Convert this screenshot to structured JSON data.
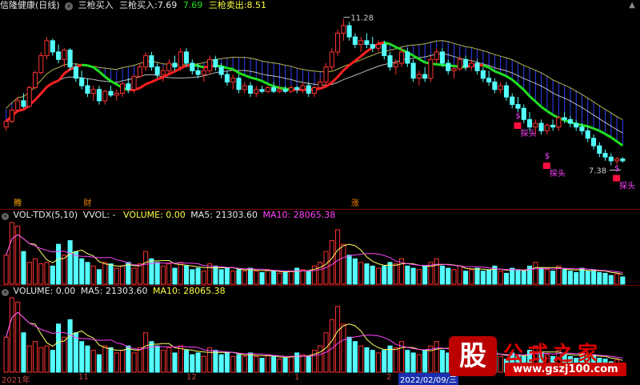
{
  "header": {
    "stock_name": "信隆健康(日线)",
    "ind1_name": "三枪买入",
    "ind2_label": "三枪买入:",
    "ind2_value": "7.69",
    "ind3_value": "7.69",
    "ind4_label": "三枪卖出:",
    "ind4_value": "8.51"
  },
  "panel2": {
    "title": "VOL-TDX(5,10)",
    "vvol": "VVOL: -",
    "volume": "VOLUME: 0.00",
    "ma5": "MA5: 21303.60",
    "ma10": "MA10: 28065.38"
  },
  "panel3": {
    "volume": "VOLUME: 0.00",
    "ma5": "MA5: 21303.60",
    "ma10": "MA10: 28065.38"
  },
  "annotations": {
    "high": "11.28",
    "low": "7.38",
    "signal_label": "探头",
    "dollar": "$",
    "bottom_marks": [
      "腾",
      "财",
      "涨"
    ]
  },
  "xaxis": {
    "labels": [
      "2021年",
      "11",
      "12",
      "1",
      "2",
      "2022/02/09/三"
    ]
  },
  "watermark": {
    "logo": "股",
    "text": "公式之家",
    "url": "www.gszj100.com"
  },
  "colors": {
    "up": "#ff3232",
    "down": "#54ffff",
    "ma_red": "#ff2020",
    "ma_green": "#20e020",
    "line_yellow": "#ffff66",
    "line_white": "#e8e8e8",
    "line_magenta": "#ff44ff",
    "cloud_blue": "#3040ff"
  },
  "chart_data": {
    "type": "candlestick",
    "period": "daily",
    "y_high": 11.28,
    "y_low": 7.38,
    "candles": [
      [
        8.4,
        8.6,
        8.3,
        8.55
      ],
      [
        8.55,
        8.9,
        8.5,
        8.85
      ],
      [
        8.85,
        9.2,
        8.8,
        9.1
      ],
      [
        9.1,
        9.3,
        8.9,
        8.95
      ],
      [
        8.95,
        9.5,
        8.9,
        9.45
      ],
      [
        9.45,
        9.9,
        9.4,
        9.85
      ],
      [
        9.85,
        10.4,
        9.8,
        10.3
      ],
      [
        10.3,
        10.8,
        10.2,
        10.7
      ],
      [
        10.7,
        10.75,
        10.3,
        10.4
      ],
      [
        10.4,
        10.6,
        10.1,
        10.2
      ],
      [
        10.2,
        10.5,
        10.0,
        10.45
      ],
      [
        10.45,
        10.5,
        9.9,
        10.0
      ],
      [
        10.0,
        10.1,
        9.6,
        9.7
      ],
      [
        9.7,
        9.9,
        9.4,
        9.5
      ],
      [
        9.5,
        9.7,
        9.2,
        9.3
      ],
      [
        9.3,
        9.5,
        9.1,
        9.4
      ],
      [
        9.4,
        9.5,
        9.0,
        9.1
      ],
      [
        9.1,
        9.4,
        9.0,
        9.35
      ],
      [
        9.35,
        9.5,
        9.2,
        9.25
      ],
      [
        9.25,
        9.4,
        9.1,
        9.3
      ],
      [
        9.3,
        9.6,
        9.2,
        9.55
      ],
      [
        9.55,
        9.7,
        9.3,
        9.4
      ],
      [
        9.4,
        9.8,
        9.3,
        9.75
      ],
      [
        9.75,
        10.1,
        9.7,
        10.0
      ],
      [
        10.0,
        10.4,
        9.9,
        10.3
      ],
      [
        10.3,
        10.4,
        9.9,
        10.0
      ],
      [
        10.0,
        10.1,
        9.7,
        9.8
      ],
      [
        9.8,
        10.0,
        9.6,
        9.9
      ],
      [
        9.9,
        10.2,
        9.8,
        10.1
      ],
      [
        10.1,
        10.3,
        9.9,
        10.0
      ],
      [
        10.0,
        10.5,
        9.9,
        10.4
      ],
      [
        10.4,
        10.5,
        10.0,
        10.1
      ],
      [
        10.1,
        10.2,
        9.8,
        9.9
      ],
      [
        9.9,
        10.1,
        9.7,
        9.8
      ],
      [
        9.8,
        10.0,
        9.6,
        9.9
      ],
      [
        9.9,
        10.3,
        9.8,
        10.2
      ],
      [
        10.2,
        10.3,
        9.9,
        10.0
      ],
      [
        10.0,
        10.1,
        9.7,
        9.8
      ],
      [
        9.8,
        9.9,
        9.5,
        9.6
      ],
      [
        9.6,
        9.8,
        9.4,
        9.7
      ],
      [
        9.7,
        9.8,
        9.3,
        9.4
      ],
      [
        9.4,
        9.6,
        9.3,
        9.5
      ],
      [
        9.5,
        9.6,
        9.2,
        9.3
      ],
      [
        9.3,
        9.5,
        9.2,
        9.4
      ],
      [
        9.4,
        9.5,
        9.3,
        9.35
      ],
      [
        9.35,
        9.5,
        9.3,
        9.45
      ],
      [
        9.45,
        9.6,
        9.3,
        9.35
      ],
      [
        9.35,
        9.5,
        9.3,
        9.4
      ],
      [
        9.4,
        9.5,
        9.3,
        9.35
      ],
      [
        9.35,
        9.5,
        9.3,
        9.45
      ],
      [
        9.45,
        9.5,
        9.3,
        9.4
      ],
      [
        9.4,
        9.6,
        9.3,
        9.5
      ],
      [
        9.5,
        9.6,
        9.2,
        9.3
      ],
      [
        9.3,
        9.5,
        9.2,
        9.45
      ],
      [
        9.45,
        9.7,
        9.4,
        9.6
      ],
      [
        9.6,
        10.1,
        9.5,
        10.0
      ],
      [
        10.0,
        10.5,
        9.9,
        10.4
      ],
      [
        10.4,
        11.0,
        10.3,
        10.9
      ],
      [
        10.9,
        11.28,
        10.7,
        11.1
      ],
      [
        11.1,
        11.2,
        10.7,
        10.8
      ],
      [
        10.8,
        10.9,
        10.5,
        10.6
      ],
      [
        10.6,
        10.8,
        10.4,
        10.7
      ],
      [
        10.7,
        10.9,
        10.5,
        10.6
      ],
      [
        10.6,
        10.8,
        10.4,
        10.5
      ],
      [
        10.5,
        10.7,
        10.4,
        10.6
      ],
      [
        10.6,
        10.7,
        10.2,
        10.3
      ],
      [
        10.3,
        10.4,
        9.9,
        10.0
      ],
      [
        10.0,
        10.2,
        9.8,
        10.1
      ],
      [
        10.1,
        10.5,
        10.0,
        10.4
      ],
      [
        10.4,
        10.5,
        10.0,
        10.1
      ],
      [
        10.1,
        10.2,
        9.6,
        9.7
      ],
      [
        9.7,
        9.9,
        9.5,
        9.8
      ],
      [
        9.8,
        10.0,
        9.6,
        9.7
      ],
      [
        9.7,
        10.3,
        9.6,
        10.2
      ],
      [
        10.2,
        10.5,
        10.1,
        10.4
      ],
      [
        10.4,
        10.5,
        10.0,
        10.1
      ],
      [
        10.1,
        10.2,
        9.8,
        9.9
      ],
      [
        9.9,
        10.0,
        9.7,
        9.95
      ],
      [
        9.95,
        10.3,
        9.9,
        10.2
      ],
      [
        10.2,
        10.3,
        9.9,
        10.0
      ],
      [
        10.0,
        10.2,
        9.9,
        10.1
      ],
      [
        10.1,
        10.2,
        9.8,
        9.9
      ],
      [
        9.9,
        10.0,
        9.6,
        9.7
      ],
      [
        9.7,
        9.9,
        9.5,
        9.6
      ],
      [
        9.6,
        9.7,
        9.3,
        9.4
      ],
      [
        9.4,
        9.6,
        9.3,
        9.5
      ],
      [
        9.5,
        9.6,
        9.1,
        9.2
      ],
      [
        9.2,
        9.3,
        8.9,
        9.0
      ],
      [
        9.0,
        9.2,
        8.8,
        8.9
      ],
      [
        8.9,
        9.0,
        8.5,
        8.6
      ],
      [
        8.6,
        8.8,
        8.3,
        8.4
      ],
      [
        8.4,
        8.6,
        8.2,
        8.5
      ],
      [
        8.5,
        8.6,
        8.2,
        8.3
      ],
      [
        8.3,
        8.5,
        8.2,
        8.45
      ],
      [
        8.45,
        8.6,
        8.3,
        8.4
      ],
      [
        8.4,
        8.7,
        8.3,
        8.65
      ],
      [
        8.65,
        8.8,
        8.5,
        8.6
      ],
      [
        8.6,
        8.7,
        8.4,
        8.5
      ],
      [
        8.5,
        8.6,
        8.3,
        8.4
      ],
      [
        8.4,
        8.5,
        8.2,
        8.3
      ],
      [
        8.3,
        8.4,
        8.0,
        8.1
      ],
      [
        8.1,
        8.2,
        7.8,
        7.9
      ],
      [
        7.9,
        8.0,
        7.6,
        7.7
      ],
      [
        7.7,
        7.8,
        7.5,
        7.6
      ],
      [
        7.6,
        7.7,
        7.38,
        7.5
      ],
      [
        7.5,
        7.6,
        7.4,
        7.55
      ],
      [
        7.55,
        7.6,
        7.45,
        7.5
      ]
    ],
    "volume": [
      40,
      85,
      80,
      45,
      30,
      35,
      28,
      30,
      25,
      55,
      40,
      60,
      45,
      35,
      30,
      25,
      20,
      30,
      28,
      22,
      25,
      30,
      22,
      28,
      45,
      35,
      30,
      25,
      28,
      22,
      30,
      25,
      20,
      22,
      18,
      28,
      25,
      20,
      22,
      18,
      20,
      18,
      22,
      18,
      16,
      20,
      18,
      15,
      16,
      18,
      22,
      20,
      18,
      25,
      30,
      45,
      60,
      75,
      55,
      40,
      35,
      30,
      28,
      25,
      22,
      25,
      30,
      28,
      35,
      25,
      22,
      20,
      25,
      30,
      35,
      25,
      22,
      20,
      25,
      18,
      20,
      22,
      18,
      20,
      25,
      18,
      15,
      22,
      20,
      18,
      25,
      30,
      22,
      20,
      18,
      25,
      20,
      18,
      16,
      22,
      18,
      20,
      16,
      15,
      12,
      14,
      10
    ]
  }
}
